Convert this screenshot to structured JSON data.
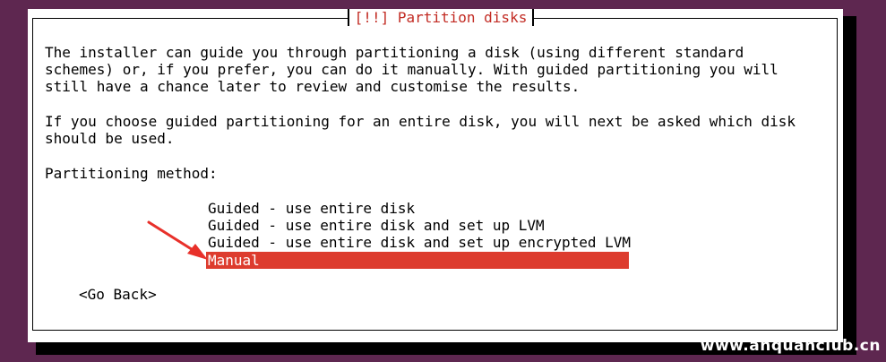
{
  "dialog": {
    "title": "[!!] Partition disks",
    "description_lines": [
      "The installer can guide you through partitioning a disk (using different standard",
      "schemes) or, if you prefer, you can do it manually. With guided partitioning you will",
      "still have a chance later to review and customise the results."
    ],
    "guided_lines": [
      "If you choose guided partitioning for an entire disk, you will next be asked which disk",
      "should be used."
    ],
    "method_label": "Partitioning method:",
    "options": [
      "Guided - use entire disk",
      "Guided - use entire disk and set up LVM",
      "Guided - use entire disk and set up encrypted LVM",
      "Manual"
    ],
    "selected_option": "Manual",
    "go_back_label": "<Go Back>"
  },
  "watermark": "www.anquanclub.cn",
  "colors": {
    "background": "#5e2750",
    "title": "#c22b23",
    "selection": "#dd3c2e",
    "annotation_arrow": "#e8302a"
  },
  "annotation": {
    "icon": "red-arrow-icon",
    "target": "Manual"
  }
}
